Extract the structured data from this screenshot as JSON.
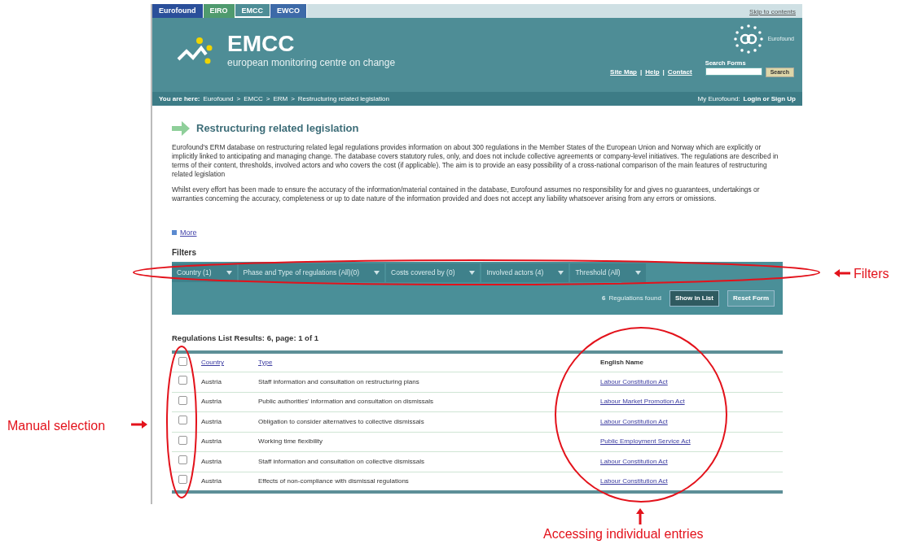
{
  "site_tabs": [
    {
      "label": "Eurofound",
      "color": "#2a4f9a",
      "selected": false
    },
    {
      "label": "EIRO",
      "color": "#4f9a6e",
      "selected": false
    },
    {
      "label": "EMCC",
      "color": "#4e8d96",
      "selected": true
    },
    {
      "label": "EWCO",
      "color": "#3d6aa8",
      "selected": false
    }
  ],
  "skip_link": "Skip to contents",
  "header": {
    "logo_title": "EMCC",
    "logo_subtitle": "european monitoring centre on change",
    "partner_logo": "Eurofound",
    "nav_links": [
      "Site Map",
      "|",
      "Help",
      "|",
      "Contact"
    ],
    "search": {
      "label": "Search Forms",
      "button": "Search"
    }
  },
  "breadcrumb": {
    "label": "You are here:",
    "items": [
      "Eurofound",
      ">",
      "EMCC",
      ">",
      "ERM",
      ">",
      "Restructuring related legislation"
    ],
    "account_label": "My Eurofound:",
    "account_link": "Login or Sign Up"
  },
  "page_title": "Restructuring related legislation",
  "paragraphs": [
    "Eurofound's ERM database on restructuring related legal regulations provides information on about 300 regulations in the Member States of the European Union and Norway which are explicitly or implicitly linked to anticipating and managing change. The database covers statutory rules, only, and does not include collective agreements or company-level initiatives. The regulations are described in terms of their content, thresholds, involved actors and who covers the cost (if applicable). The aim is to provide an easy possibility of a cross-national comparison of the main features of restructuring related legislation",
    "Whilst every effort has been made to ensure the accuracy of the information/material contained in the database, Eurofound assumes no responsibility for and gives no guarantees, undertakings or warranties concerning the accuracy, completeness or up to date nature of the information provided and does not accept any liability whatsoever arising from any errors or omissions."
  ],
  "more_link": "More",
  "filters": {
    "heading": "Filters",
    "tabs": [
      "Country (1)",
      "Phase and Type of regulations (All)(0)",
      "Costs covered by (0)",
      "Involved actors (4)",
      "Threshold (All)"
    ],
    "found_count": "6",
    "found_label": "Regulations found",
    "buttons": [
      "Show in List",
      "Reset Form"
    ]
  },
  "results_heading": "Regulations List Results: 6, page: 1 of 1",
  "table": {
    "columns": [
      "Country",
      "Type",
      "English Name"
    ],
    "select_all_checked": false,
    "rows": [
      {
        "checked": false,
        "country": "Austria",
        "type": "Staff information and consultation on restructuring plans",
        "english_name": "Labour Constitution Act"
      },
      {
        "checked": false,
        "country": "Austria",
        "type": "Public authorities' information and consultation on dismissals",
        "english_name": "Labour Market Promotion Act"
      },
      {
        "checked": false,
        "country": "Austria",
        "type": "Obligation to consider alternatives to collective dismissals",
        "english_name": "Labour Constitution Act"
      },
      {
        "checked": false,
        "country": "Austria",
        "type": "Working time flexibility",
        "english_name": "Public Employment Service Act"
      },
      {
        "checked": false,
        "country": "Austria",
        "type": "Staff information and consultation on collective dismissals",
        "english_name": "Labour Constitution Act"
      },
      {
        "checked": false,
        "country": "Austria",
        "type": "Effects of non-compliance with dismissal regulations",
        "english_name": "Labour Constitution Act"
      }
    ]
  },
  "annotations": {
    "filters": "Filters",
    "manual_selection": "Manual selection",
    "individual_entries": "Accessing individual entries"
  }
}
